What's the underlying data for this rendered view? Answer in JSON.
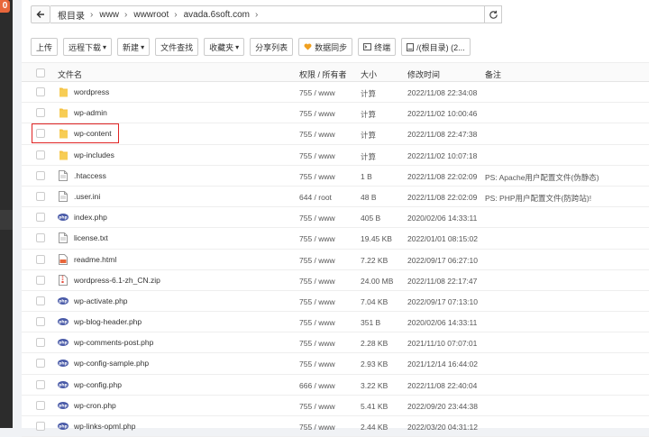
{
  "sidebar": {
    "badge": "0"
  },
  "address": {
    "crumbs": [
      "根目录",
      "www",
      "wwwroot",
      "avada.6soft.com"
    ]
  },
  "toolbar": {
    "upload": "上传",
    "remote_download": "远程下载",
    "new": "新建",
    "file_search": "文件查找",
    "favorites": "收藏夹",
    "share_list": "分享列表",
    "data_sync": "数据同步",
    "terminal": "终端",
    "path_tab": "/(根目录) (2..."
  },
  "columns": {
    "name": "文件名",
    "perm": "权限 / 所有者",
    "size": "大小",
    "mtime": "修改时间",
    "note": "备注"
  },
  "files": [
    {
      "icon": "folder",
      "name": "wordpress",
      "perm": "755 / www",
      "size": "计算",
      "mtime": "2022/11/08 22:34:08",
      "note": ""
    },
    {
      "icon": "folder",
      "name": "wp-admin",
      "perm": "755 / www",
      "size": "计算",
      "mtime": "2022/11/02 10:00:46",
      "note": ""
    },
    {
      "icon": "folder",
      "name": "wp-content",
      "perm": "755 / www",
      "size": "计算",
      "mtime": "2022/11/08 22:47:38",
      "note": ""
    },
    {
      "icon": "folder",
      "name": "wp-includes",
      "perm": "755 / www",
      "size": "计算",
      "mtime": "2022/11/02 10:07:18",
      "note": ""
    },
    {
      "icon": "file",
      "name": ".htaccess",
      "perm": "755 / www",
      "size": "1 B",
      "mtime": "2022/11/08 22:02:09",
      "note": "PS: Apache用户配置文件(伪静态)"
    },
    {
      "icon": "file",
      "name": ".user.ini",
      "perm": "644 / root",
      "size": "48 B",
      "mtime": "2022/11/08 22:02:09",
      "note": "PS: PHP用户配置文件(防跨站)!"
    },
    {
      "icon": "php",
      "name": "index.php",
      "perm": "755 / www",
      "size": "405 B",
      "mtime": "2020/02/06 14:33:11",
      "note": ""
    },
    {
      "icon": "file",
      "name": "license.txt",
      "perm": "755 / www",
      "size": "19.45 KB",
      "mtime": "2022/01/01 08:15:02",
      "note": ""
    },
    {
      "icon": "html",
      "name": "readme.html",
      "perm": "755 / www",
      "size": "7.22 KB",
      "mtime": "2022/09/17 06:27:10",
      "note": ""
    },
    {
      "icon": "zip",
      "name": "wordpress-6.1-zh_CN.zip",
      "perm": "755 / www",
      "size": "24.00 MB",
      "mtime": "2022/11/08 22:17:47",
      "note": ""
    },
    {
      "icon": "php",
      "name": "wp-activate.php",
      "perm": "755 / www",
      "size": "7.04 KB",
      "mtime": "2022/09/17 07:13:10",
      "note": ""
    },
    {
      "icon": "php",
      "name": "wp-blog-header.php",
      "perm": "755 / www",
      "size": "351 B",
      "mtime": "2020/02/06 14:33:11",
      "note": ""
    },
    {
      "icon": "php",
      "name": "wp-comments-post.php",
      "perm": "755 / www",
      "size": "2.28 KB",
      "mtime": "2021/11/10 07:07:01",
      "note": ""
    },
    {
      "icon": "php",
      "name": "wp-config-sample.php",
      "perm": "755 / www",
      "size": "2.93 KB",
      "mtime": "2021/12/14 16:44:02",
      "note": ""
    },
    {
      "icon": "php",
      "name": "wp-config.php",
      "perm": "666 / www",
      "size": "3.22 KB",
      "mtime": "2022/11/08 22:40:04",
      "note": ""
    },
    {
      "icon": "php",
      "name": "wp-cron.php",
      "perm": "755 / www",
      "size": "5.41 KB",
      "mtime": "2022/09/20 23:44:38",
      "note": ""
    },
    {
      "icon": "php",
      "name": "wp-links-opml.php",
      "perm": "755 / www",
      "size": "2.44 KB",
      "mtime": "2022/03/20 04:31:12",
      "note": ""
    }
  ],
  "colors": {
    "folder": "#f5c242",
    "green": "#20a53a",
    "highlight": "#e02424",
    "php": "#4a5ba8"
  }
}
